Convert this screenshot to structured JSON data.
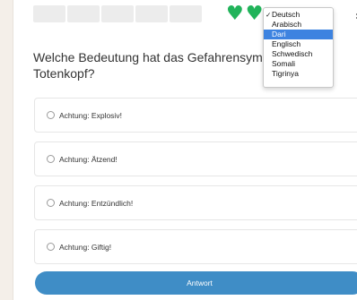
{
  "progress": {
    "segments": 5
  },
  "hearts": {
    "count": 2,
    "glyph": "♥",
    "color": "#21b35a"
  },
  "close": {
    "glyph": "✖"
  },
  "question": {
    "text": "Welche Bedeutung hat das Gefahrensymbol mit Totenkopf?"
  },
  "options": [
    {
      "label": "Achtung: Explosiv!"
    },
    {
      "label": "Achtung: Ätzend!"
    },
    {
      "label": "Achtung: Entzündlich!"
    },
    {
      "label": "Achtung: Giftig!"
    }
  ],
  "answer_button": {
    "label": "Antwort",
    "color": "#3f8dc6"
  },
  "language_dropdown": {
    "checked": "Deutsch",
    "highlighted": "Dari",
    "check_glyph": "✓",
    "options": [
      "Deutsch",
      "Arabisch",
      "Dari",
      "Englisch",
      "Schwedisch",
      "Somali",
      "Tigrinya"
    ],
    "highlight_color": "#3d83e0"
  }
}
